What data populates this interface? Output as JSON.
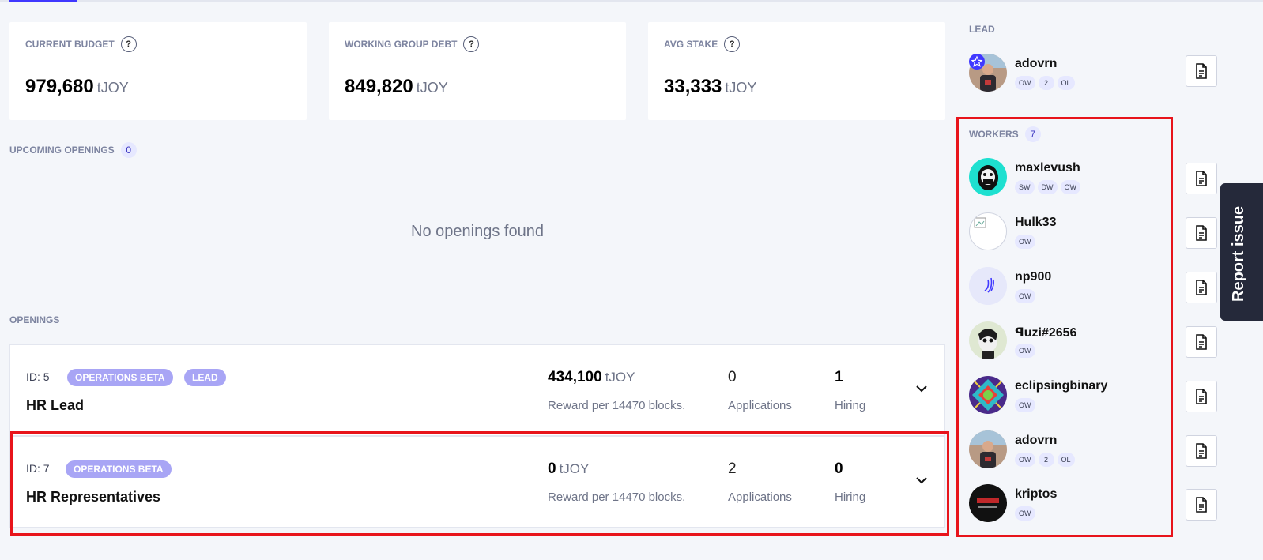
{
  "stats": [
    {
      "label": "CURRENT BUDGET",
      "value": "979,680",
      "unit": "tJOY"
    },
    {
      "label": "WORKING GROUP DEBT",
      "value": "849,820",
      "unit": "tJOY"
    },
    {
      "label": "AVG STAKE",
      "value": "33,333",
      "unit": "tJOY"
    }
  ],
  "help_glyph": "?",
  "upcoming": {
    "label": "UPCOMING OPENINGS",
    "count": "0",
    "empty_text": "No openings found"
  },
  "openings": {
    "label": "OPENINGS",
    "items": [
      {
        "id": "ID: 5",
        "badges": [
          "OPERATIONS BETA",
          "LEAD"
        ],
        "title": "HR Lead",
        "reward": "434,100",
        "unit": "tJOY",
        "reward_sub": "Reward per 14470 blocks.",
        "applications": "0",
        "applications_label": "Applications",
        "hiring": "1",
        "hiring_label": "Hiring"
      },
      {
        "id": "ID: 7",
        "badges": [
          "OPERATIONS BETA"
        ],
        "title": "HR Representatives",
        "reward": "0",
        "unit": "tJOY",
        "reward_sub": "Reward per 14470 blocks.",
        "applications": "2",
        "applications_label": "Applications",
        "hiring": "0",
        "hiring_label": "Hiring"
      }
    ]
  },
  "lead": {
    "label": "LEAD",
    "name": "adovrn",
    "roles": [
      "OW",
      "2",
      "OL"
    ]
  },
  "workers": {
    "label": "WORKERS",
    "count": "7",
    "items": [
      {
        "name": "maxlevush",
        "roles": [
          "SW",
          "DW",
          "OW"
        ]
      },
      {
        "name": "Hulk33",
        "roles": [
          "OW"
        ]
      },
      {
        "name": "np900",
        "roles": [
          "OW"
        ]
      },
      {
        "name": "ꟼuzi#2656",
        "roles": [
          "OW"
        ]
      },
      {
        "name": "eclipsingbinary",
        "roles": [
          "OW"
        ]
      },
      {
        "name": "adovrn",
        "roles": [
          "OW",
          "2",
          "OL"
        ]
      },
      {
        "name": "kriptos",
        "roles": [
          "OW"
        ]
      }
    ]
  },
  "report_tab": "Report issue",
  "colors": {
    "accent": "#4038ff",
    "badge": "#a8a5f5",
    "highlight": "#e8141b"
  }
}
